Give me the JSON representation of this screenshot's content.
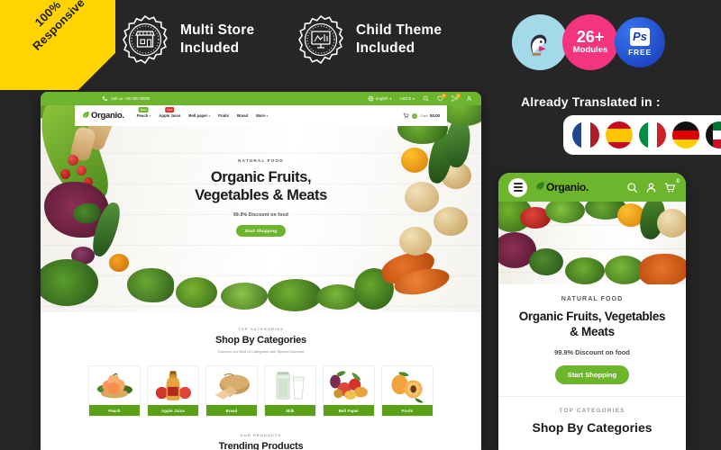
{
  "ribbon": {
    "line1": "100%",
    "line2": "Responsive"
  },
  "features": [
    {
      "icon": "store-badge-icon",
      "line1": "Multi Store",
      "line2": "Included"
    },
    {
      "icon": "child-theme-badge-icon",
      "line1": "Child Theme",
      "line2": "Included"
    }
  ],
  "badges": {
    "prestashop_icon": "prestashop-bird-icon",
    "modules_count": "26+",
    "modules_label": "Modules",
    "ps_mark": "Ps",
    "ps_free": "FREE",
    "colors": {
      "presta_bg": "#a3d9e8",
      "modules_bg": "#f5347f",
      "ps_bg": "#1d53d6"
    }
  },
  "translated": {
    "title": "Already Translated in :",
    "flags": [
      "France",
      "Spain",
      "Italy",
      "Germany",
      "United Arab Emirates"
    ]
  },
  "desktop": {
    "topbar": {
      "phone_icon": "phone-icon",
      "phone": "Call us: +00 000 00000",
      "language": "English",
      "currency": "USD $",
      "search_icon": "search-icon",
      "wishlist_icon": "heart-icon",
      "wishlist_count": "0",
      "compare_icon": "compare-icon",
      "compare_count": "0",
      "account_icon": "user-icon"
    },
    "logo": {
      "text": "Organio.",
      "icon": "leaf-icon"
    },
    "menu": [
      {
        "label": "Peach",
        "caret": "▾",
        "tag": "New",
        "tag_type": "new"
      },
      {
        "label": "Apple Juice",
        "caret": "",
        "tag": "Hot",
        "tag_type": "hot"
      },
      {
        "label": "Bell paper",
        "caret": "▾",
        "tag": "",
        "tag_type": ""
      },
      {
        "label": "Fruits",
        "caret": "",
        "tag": "",
        "tag_type": ""
      },
      {
        "label": "Bread",
        "caret": "",
        "tag": "",
        "tag_type": ""
      },
      {
        "label": "More",
        "caret": "▾",
        "tag": "",
        "tag_type": ""
      }
    ],
    "cart": {
      "icon": "cart-icon",
      "count": "0",
      "label": "Cart",
      "price": "$0.00"
    },
    "hero": {
      "kicker": "NATURAL FOOD",
      "title_line1": "Organic Fruits,",
      "title_line2": "Vegetables & Meats",
      "subtitle": "99.9% Discount on food",
      "cta": "Start Shopping"
    },
    "categories_section": {
      "kicker": "TOP CATEGORIES",
      "title": "Shop By Categories",
      "description": "Discover our Best of Categories with Special Discount",
      "items": [
        {
          "label": "Peach",
          "image": "peach-bowl-image"
        },
        {
          "label": "Apple Juice",
          "image": "apple-juice-bottle-image"
        },
        {
          "label": "Bread",
          "image": "bread-loaf-image"
        },
        {
          "label": "Milk",
          "image": "milk-glass-image"
        },
        {
          "label": "Bell Paper",
          "image": "vegetables-image"
        },
        {
          "label": "Fruits",
          "image": "apricot-image"
        }
      ]
    },
    "trending_section": {
      "kicker": "OUR PRODUCTS",
      "title": "Trending Products"
    }
  },
  "mobile": {
    "header": {
      "menu_icon": "hamburger-icon",
      "logo": "Organio.",
      "logo_icon": "leaf-icon",
      "search_icon": "search-icon",
      "user_icon": "user-icon",
      "cart_icon": "cart-icon",
      "cart_count": "0"
    },
    "hero": {
      "kicker": "NATURAL FOOD",
      "title_line1": "Organic Fruits, Vegetables",
      "title_line2": "& Meats",
      "subtitle": "99.9% Discount on food",
      "cta": "Start Shopping"
    },
    "categories_section": {
      "kicker": "TOP CATEGORIES",
      "title": "Shop By Categories"
    }
  },
  "theme": {
    "green": "#6cb52c",
    "dark_bg": "#262626",
    "ribbon_yellow": "#ffd400"
  }
}
